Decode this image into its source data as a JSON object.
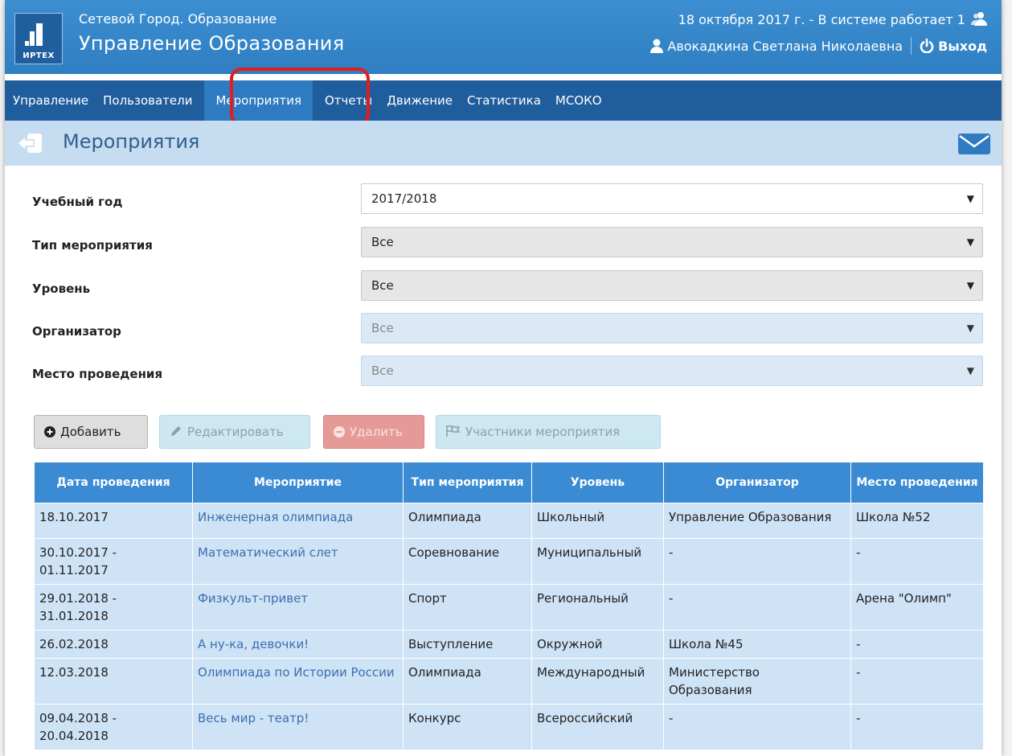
{
  "header": {
    "logo_text": "ИРТЕХ",
    "org_subtitle": "Сетевой Город. Образование",
    "org_title": "Управление Образования",
    "date_status": "18 октября 2017 г. - В системе работает 1",
    "user_name": "Авокадкина Светлана Николаевна",
    "logout_label": "Выход"
  },
  "nav": {
    "items": [
      "Управление",
      "Пользователи",
      "Мероприятия",
      "Отчеты",
      "Движение",
      "Статистика",
      "МСОКО"
    ],
    "active": "Мероприятия"
  },
  "page": {
    "title": "Мероприятия"
  },
  "filters": {
    "year": {
      "label": "Учебный год",
      "value": "2017/2018"
    },
    "type": {
      "label": "Тип мероприятия",
      "value": "Все"
    },
    "level": {
      "label": "Уровень",
      "value": "Все"
    },
    "organizer": {
      "label": "Организатор",
      "value": "Все"
    },
    "place": {
      "label": "Место проведения",
      "value": "Все"
    }
  },
  "buttons": {
    "add": "Добавить",
    "edit": "Редактировать",
    "delete": "Удалить",
    "participants": "Участники мероприятия"
  },
  "table": {
    "headers": [
      "Дата проведения",
      "Мероприятие",
      "Тип мероприятия",
      "Уровень",
      "Организатор",
      "Место проведения"
    ],
    "rows": [
      [
        "18.10.2017",
        "Инженерная олимпиада",
        "Олимпиада",
        "Школьный",
        "Управление Образования",
        "Школа №52"
      ],
      [
        "30.10.2017 - 01.11.2017",
        "Математический слет",
        "Соревнование",
        "Муниципальный",
        "-",
        "-"
      ],
      [
        "29.01.2018 - 31.01.2018",
        "Физкульт-привет",
        "Спорт",
        "Региональный",
        "-",
        "Арена \"Олимп\""
      ],
      [
        "26.02.2018",
        "А ну-ка, девочки!",
        "Выступление",
        "Окружной",
        "Школа №45",
        "-"
      ],
      [
        "12.03.2018",
        "Олимпиада по Истории России",
        "Олимпиада",
        "Международный",
        "Министерство Образования",
        "-"
      ],
      [
        "09.04.2018 - 20.04.2018",
        "Весь мир - театр!",
        "Конкурс",
        "Всероссийский",
        "-",
        "-"
      ]
    ]
  },
  "colors": {
    "header_blue": "#2f7ec2",
    "nav_blue": "#1f5d9c",
    "highlight_red": "#e11d1d",
    "table_header": "#3a8bd4",
    "table_row": "#cfe3f6"
  }
}
